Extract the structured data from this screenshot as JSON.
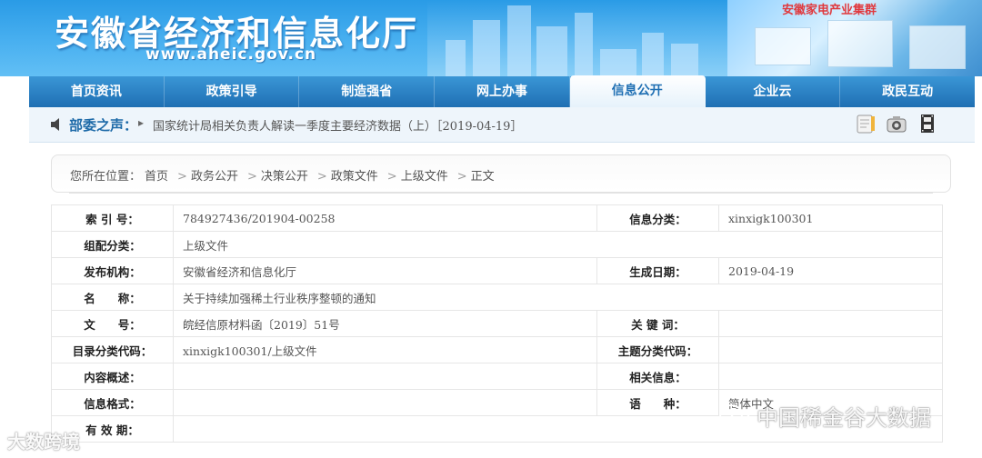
{
  "banner": {
    "title": "安徽省经济和信息化厅",
    "url": "www.aheic.gov.cn",
    "photo_text": "安徽家电产业集群"
  },
  "nav": {
    "items": [
      {
        "label": "首页资讯"
      },
      {
        "label": "政策引导"
      },
      {
        "label": "制造强省"
      },
      {
        "label": "网上办事"
      },
      {
        "label": "信息公开",
        "active": true
      },
      {
        "label": "企业云"
      },
      {
        "label": "政民互动"
      }
    ]
  },
  "ticker": {
    "label": "部委之声：",
    "text": "国家统计局相关负责人解读一季度主要经济数据（上）［2019-04-19］",
    "icons": [
      "notepad-icon",
      "camera-icon",
      "film-icon"
    ]
  },
  "breadcrumb": {
    "prefix": "您所在位置：",
    "items": [
      "首页",
      "政务公开",
      "决策公开",
      "政策文件",
      "上级文件",
      "正文"
    ]
  },
  "meta": {
    "index_label": "索 引 号：",
    "index_value": "784927436/201904-00258",
    "category_label": "信息分类：",
    "category_value": "xinxigk100301",
    "group_label": "组配分类：",
    "group_value": "上级文件",
    "publisher_label": "发布机构：",
    "publisher_value": "安徽省经济和信息化厅",
    "date_label": "生成日期：",
    "date_value": "2019-04-19",
    "name_label": "名　　称：",
    "name_value": "关于持续加强稀土行业秩序整顿的通知",
    "docno_label": "文　　号：",
    "docno_value": "皖经信原材料函〔2019〕51号",
    "keywords_label": "关 键 词：",
    "keywords_value": "",
    "catalog_label": "目录分类代码：",
    "catalog_value": "xinxigk100301/上级文件",
    "topic_label": "主题分类代码：",
    "topic_value": "",
    "summary_label": "内容概述：",
    "summary_value": "",
    "related_label": "相关信息：",
    "related_value": "",
    "format_label": "信息格式：",
    "format_value": "",
    "language_label": "语　　种：",
    "language_value": "简体中文",
    "validity_label": "有 效 期："
  },
  "watermarks": {
    "left": "大数跨境",
    "right": "中国稀金谷大数据"
  }
}
